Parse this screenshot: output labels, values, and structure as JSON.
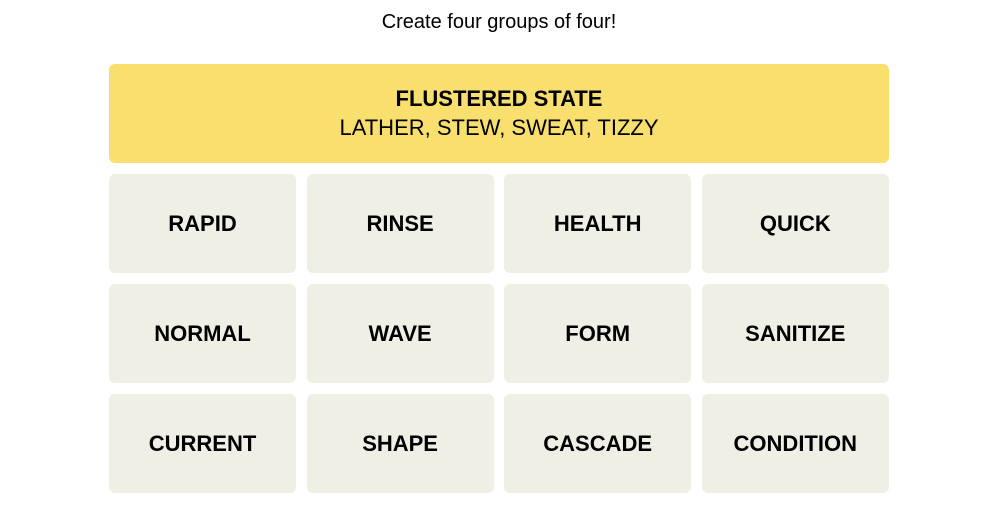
{
  "subtitle": "Create four groups of four!",
  "solved_groups": [
    {
      "category": "FLUSTERED STATE",
      "words": "LATHER, STEW, SWEAT, TIZZY",
      "color": "#f9df6d"
    }
  ],
  "tiles": [
    "RAPID",
    "RINSE",
    "HEALTH",
    "QUICK",
    "NORMAL",
    "WAVE",
    "FORM",
    "SANITIZE",
    "CURRENT",
    "SHAPE",
    "CASCADE",
    "CONDITION"
  ],
  "colors": {
    "tile_bg": "#efefe6",
    "solved_yellow": "#f9df6d"
  }
}
